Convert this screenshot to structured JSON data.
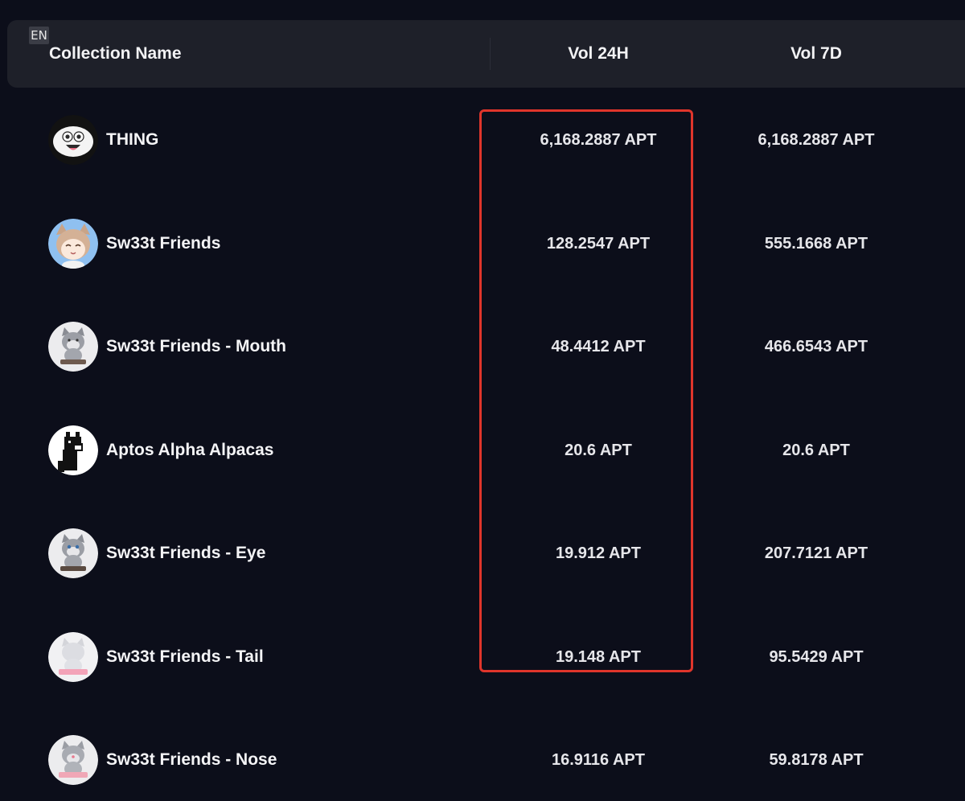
{
  "lang_badge": "EN",
  "table": {
    "columns": {
      "name": "Collection Name",
      "vol24": "Vol 24H",
      "vol7": "Vol 7D"
    },
    "rows": [
      {
        "name": "THING",
        "vol24": "6,168.2887 APT",
        "vol7": "6,168.2887 APT",
        "avatar": "thing-face"
      },
      {
        "name": "Sw33t Friends",
        "vol24": "128.2547 APT",
        "vol7": "555.1668 APT",
        "avatar": "cat-girl"
      },
      {
        "name": "Sw33t Friends - Mouth",
        "vol24": "48.4412 APT",
        "vol7": "466.6543 APT",
        "avatar": "grey-cat"
      },
      {
        "name": "Aptos Alpha Alpacas",
        "vol24": "20.6 APT",
        "vol7": "20.6 APT",
        "avatar": "pixel-alpaca"
      },
      {
        "name": "Sw33t Friends - Eye",
        "vol24": "19.912 APT",
        "vol7": "207.7121 APT",
        "avatar": "grey-cat"
      },
      {
        "name": "Sw33t Friends - Tail",
        "vol24": "19.148 APT",
        "vol7": "95.5429 APT",
        "avatar": "white-cat-pink"
      },
      {
        "name": "Sw33t Friends - Nose",
        "vol24": "16.9116 APT",
        "vol7": "59.8178 APT",
        "avatar": "grey-cat-pink"
      }
    ]
  },
  "colors": {
    "background": "#0c0e1a",
    "header_bg": "#1e2029",
    "highlight": "#e0352b"
  }
}
